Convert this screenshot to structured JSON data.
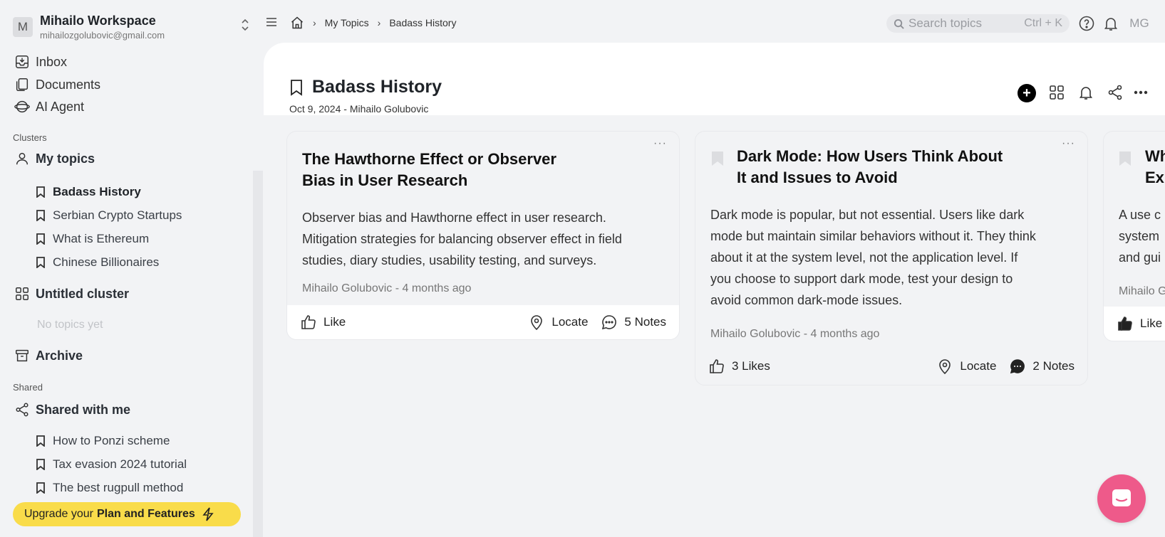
{
  "workspace": {
    "avatar_letter": "M",
    "name": "Mihailo Workspace",
    "email": "mihailozgolubovic@gmail.com"
  },
  "nav": [
    {
      "label": "Inbox",
      "icon": "inbox-icon"
    },
    {
      "label": "Documents",
      "icon": "documents-icon"
    },
    {
      "label": "AI Agent",
      "icon": "ai-agent-icon"
    }
  ],
  "sections": {
    "clusters": "Clusters",
    "shared": "Shared"
  },
  "my_topics": {
    "label": "My topics",
    "items": [
      "Badass History",
      "Serbian Crypto Startups",
      "What is Ethereum",
      "Chinese Billionaires"
    ],
    "active": "Badass History"
  },
  "untitled_cluster": {
    "label": "Untitled cluster",
    "empty": "No topics yet"
  },
  "archive": {
    "label": "Archive"
  },
  "shared_with_me": {
    "label": "Shared with me",
    "items": [
      "How to Ponzi scheme",
      "Tax evasion 2024 tutorial",
      "The best rugpull method"
    ]
  },
  "upgrade": {
    "prefix": "Upgrade your",
    "bold": "Plan and Features"
  },
  "breadcrumb": {
    "items": [
      "My Topics",
      "Badass History"
    ]
  },
  "search": {
    "placeholder": "Search topics",
    "shortcut": "Ctrl + K"
  },
  "user": {
    "initials": "MG"
  },
  "page": {
    "title": "Badass History",
    "meta": "Oct 9, 2024 - Mihailo Golubovic"
  },
  "cards": [
    {
      "title_lines": [
        "The Hawthorne Effect or Observer",
        "Bias in User Research"
      ],
      "desc_lines": [
        "Observer bias and Hawthorne effect in user research.",
        "Mitigation strategies for balancing observer effect in field",
        "studies, diary studies, usability testing, and surveys."
      ],
      "meta": "Mihailo Golubovic - 4 months ago",
      "like": "Like",
      "locate": "Locate",
      "notes": "5 Notes"
    },
    {
      "title_lines": [
        "Dark Mode: How Users Think About",
        "It and Issues to Avoid"
      ],
      "desc_lines": [
        "Dark mode is popular, but not essential. Users like dark",
        "mode but maintain similar behaviors without it. They think",
        "about it at the system level, not the application level. If",
        "you choose to support dark mode, test your design to",
        "avoid common dark-mode issues."
      ],
      "meta": "Mihailo Golubovic - 4 months ago",
      "like": "3 Likes",
      "locate": "Locate",
      "notes": "2 Notes"
    },
    {
      "title_lines": [
        "Wh",
        "Ex"
      ],
      "desc_lines": [
        "A use c",
        "system",
        "and gui"
      ],
      "meta": "Mihailo G",
      "like": "Like"
    }
  ],
  "colors": {
    "upgrade": "#f9dc4a",
    "chat_fab": "#ee5a8a",
    "accent_dark": "#000000"
  }
}
